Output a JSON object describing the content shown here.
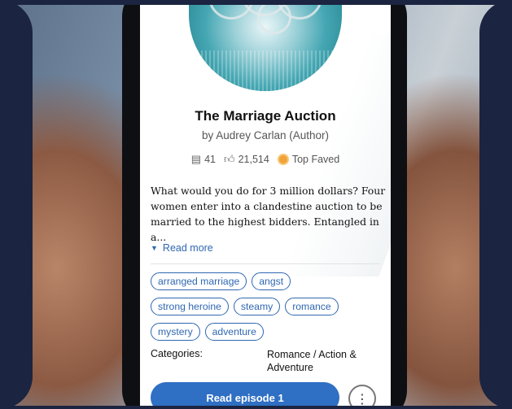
{
  "book": {
    "title": "The Marriage Auction",
    "author": "by Audrey Carlan (Author)",
    "episodes": "41",
    "likes": "21,514",
    "badge": "Top Faved",
    "description": "What would you do for 3 million dollars? Four women enter into a clandestine auction to be married to the highest bidders. Entangled in a...",
    "read_more": "Read more"
  },
  "tags": [
    [
      "arranged marriage",
      "angst"
    ],
    [
      "strong heroine",
      "steamy",
      "romance"
    ],
    [
      "mystery",
      "adventure"
    ]
  ],
  "categories": {
    "label": "Categories:",
    "value": "Romance / Action & Adventure"
  },
  "actions": {
    "read_label": "Read episode 1"
  },
  "icons": {
    "episodes": "book-pages-icon",
    "likes": "thumbs-up-icon",
    "badge": "medal-icon",
    "read_more": "chevron-down-icon",
    "more": "more-vertical-icon"
  },
  "colors": {
    "accent": "#2f6fc4",
    "background_frame": "#1b2440",
    "badge": "#f2a23a"
  }
}
